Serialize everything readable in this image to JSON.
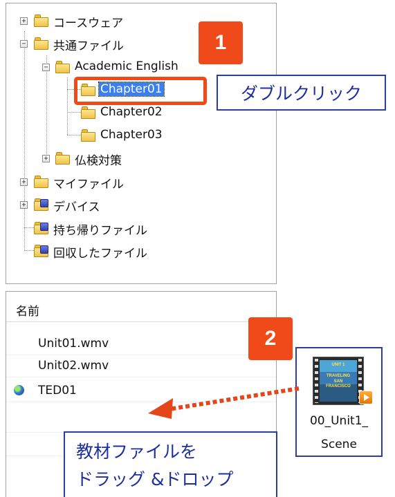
{
  "tree": {
    "items": [
      {
        "label": "コースウェア",
        "expander": "+"
      },
      {
        "label": "共通ファイル",
        "expander": "−"
      },
      {
        "label": "Academic English",
        "expander": "−"
      },
      {
        "label": "Chapter01",
        "selected": true
      },
      {
        "label": "Chapter02"
      },
      {
        "label": "Chapter03"
      },
      {
        "label": "仏検対策",
        "expander": "+"
      },
      {
        "label": "マイファイル",
        "expander": "+"
      },
      {
        "label": "デバイス",
        "expander": "+"
      },
      {
        "label": "持ち帰りファイル"
      },
      {
        "label": "回収したファイル"
      }
    ]
  },
  "file_list": {
    "header": "名前",
    "rows": [
      {
        "name": "Unit01.wmv",
        "icon": ""
      },
      {
        "name": "Unit02.wmv",
        "icon": ""
      },
      {
        "name": "TED01",
        "icon": "globe-icon"
      }
    ]
  },
  "steps": {
    "step1": {
      "number": "1",
      "text": "ダブルクリック"
    },
    "step2": {
      "number": "2",
      "text_line1": "教材ファイルを",
      "text_line2": "ドラッグ &ドロップ"
    }
  },
  "desktop_icon": {
    "caption_line1": "00_Unit1_",
    "caption_line2": "Scene",
    "thumb_text": [
      "UNIT 1",
      "TRAVELING",
      "SAN FRANCISCO"
    ]
  },
  "colors": {
    "accent_orange": "#f04a1a",
    "callout_blue": "#2a3da5",
    "selection_blue": "#3a7ff0"
  }
}
